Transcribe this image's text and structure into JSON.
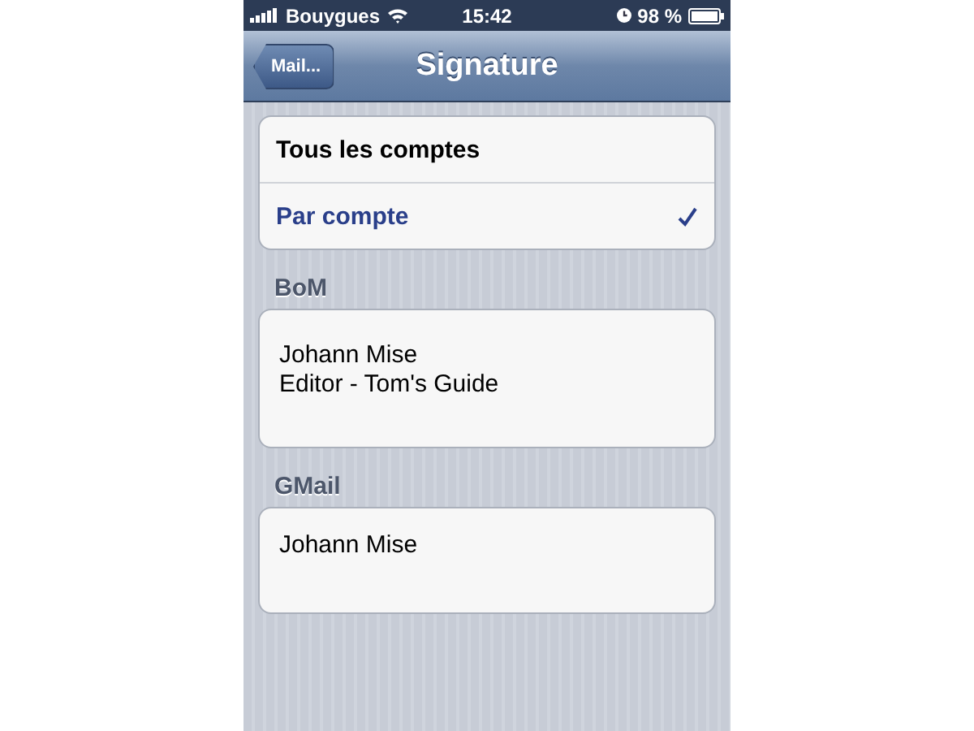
{
  "status_bar": {
    "carrier": "Bouygues",
    "time": "15:42",
    "battery": "98 %"
  },
  "nav": {
    "back": "Mail...",
    "title": "Signature"
  },
  "options": [
    {
      "label": "Tous les comptes",
      "selected": false
    },
    {
      "label": "Par compte",
      "selected": true
    }
  ],
  "accounts": [
    {
      "name": "BoM",
      "signature": [
        "Johann Mise",
        "Editor - Tom's Guide"
      ]
    },
    {
      "name": "GMail",
      "signature": [
        "Johann Mise"
      ]
    }
  ]
}
